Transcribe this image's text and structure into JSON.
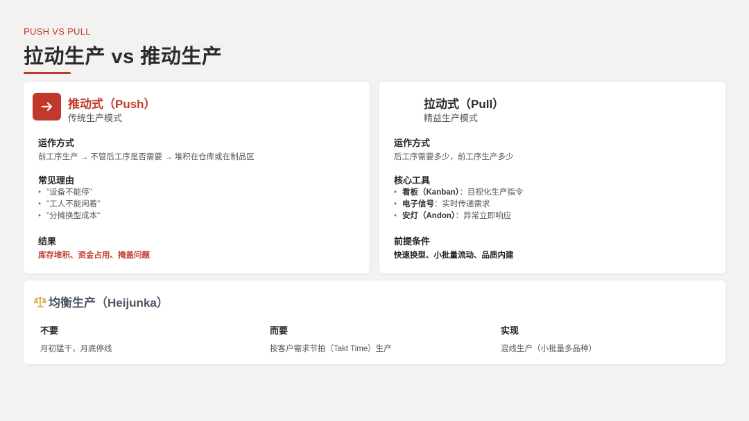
{
  "header": {
    "eyebrow": "PUSH VS PULL",
    "title": "拉动生产 vs 推动生产",
    "accent_color": "#c0392b"
  },
  "push": {
    "icon": "arrow-right-icon",
    "title": "推动式（Push）",
    "subtitle": "传统生产模式",
    "operation_title": "运作方式",
    "operation_text": "前工序生产 → 不管后工序是否需要 → 堆积在仓库或在制品区",
    "reasons_title": "常见理由",
    "reasons": [
      "\"设备不能停\"",
      "\"工人不能闲着\"",
      "\"分摊换型成本\""
    ],
    "result_title": "结果",
    "result_text": "库存堆积、资金占用、掩盖问题"
  },
  "pull": {
    "title": "拉动式（Pull）",
    "subtitle": "精益生产模式",
    "operation_title": "运作方式",
    "operation_text": "后工序需要多少，前工序生产多少",
    "tools_title": "核心工具",
    "tools": [
      {
        "name": "看板（Kanban）",
        "desc": "：目视化生产指令"
      },
      {
        "name": "电子信号",
        "desc": "：实时传递需求"
      },
      {
        "name": "安灯（Andon）",
        "desc": "：异常立即响应"
      }
    ],
    "prereq_title": "前提条件",
    "prereq_text": "快速换型、小批量流动、品质内建"
  },
  "heijunka": {
    "icon": "balance-scale-icon",
    "title": "均衡生产（Heijunka）",
    "columns": [
      {
        "label": "不要",
        "text": "月初猛干，月底停线"
      },
      {
        "label": "而要",
        "text": "按客户需求节拍（Takt Time）生产"
      },
      {
        "label": "实现",
        "text": "混线生产（小批量多品种）"
      }
    ]
  }
}
